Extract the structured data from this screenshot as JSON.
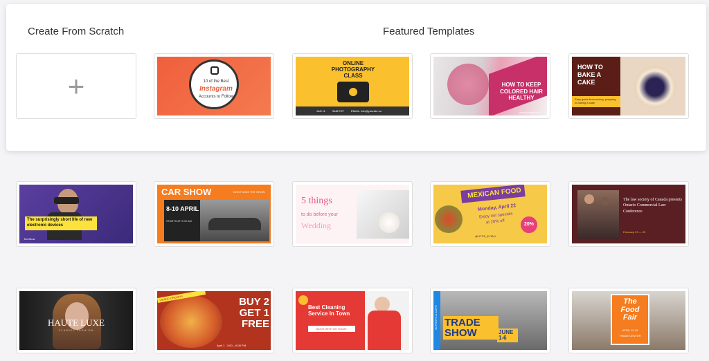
{
  "headings": {
    "scratch": "Create From Scratch",
    "featured": "Featured Templates"
  },
  "scratch_card": {
    "icon": "plus-icon"
  },
  "templates": [
    {
      "name": "instagram",
      "lines": [
        "10 of the Best",
        "Instagram",
        "Accounts to Follow"
      ]
    },
    {
      "name": "photography",
      "title": "ONLINE PHOTOGRAPHY CLASS",
      "bar": [
        "JAN 11",
        "9AM EST",
        "EMAIL: info@yoursite.co"
      ]
    },
    {
      "name": "hair",
      "title": "HOW TO KEEP COLORED HAIR HEALTHY",
      "site": "www.yoursite.co"
    },
    {
      "name": "cake",
      "title": "HOW TO BAKE A CAKE",
      "sub": "Easy guide from mixing, prepping to baking a cake"
    },
    {
      "name": "vr",
      "title": "The surprisingly short life of new electronic devices",
      "brand": "TechNow"
    },
    {
      "name": "carshow",
      "title": "CAR SHOW",
      "date": "8-10 APRIL",
      "info": "STARTS AT 9:00 AM",
      "tag": "DON'T MISS THE SHOW"
    },
    {
      "name": "wedding",
      "title": "5 things",
      "sub": "to do before your",
      "word": "Wedding"
    },
    {
      "name": "mexican",
      "title": "MEXICAN FOOD",
      "date": "Monday, April 22",
      "line1": "Enjoy our specials",
      "line2": "at 20% off",
      "badge": "20%",
      "handle": "@LITSS_ELTAH"
    },
    {
      "name": "law",
      "title": "The law society of Canada presents Ontario Commercial Law Conference",
      "date": "February 23 — 25"
    },
    {
      "name": "haute",
      "title": "HAUTE LUXE",
      "sub": "CLASSIC FASHION"
    },
    {
      "name": "food",
      "title": "BUY 2 GET 1 FREE",
      "date": "April 1 · 3:00 – 6:00 PM",
      "ribbon": "GRAND OPENING"
    },
    {
      "name": "cleaning",
      "title": "Best Cleaning Service In Town",
      "cta": "BOOK WITH US TODAY"
    },
    {
      "name": "trade",
      "title": "TRADE SHOW",
      "date": "JUNE 1-6",
      "side": "30 POSTS & CLIPS"
    },
    {
      "name": "foodfair",
      "title": "The Food Fair",
      "date": "APRIL 10-15",
      "sub": "TRADE CENTER"
    }
  ],
  "colors": {
    "accent": "#f26b3a"
  }
}
